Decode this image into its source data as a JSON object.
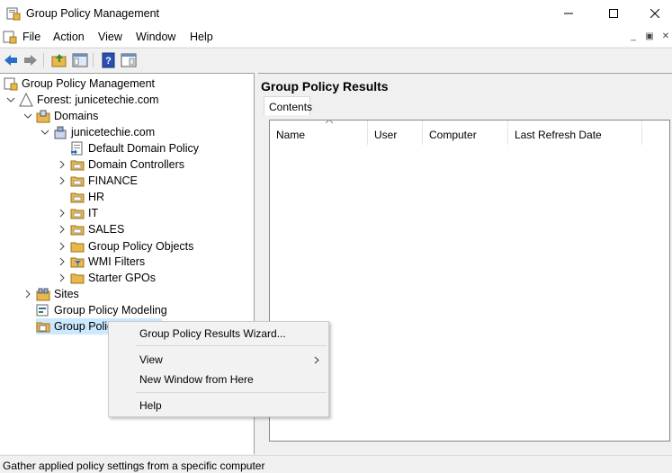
{
  "window": {
    "title": "Group Policy Management"
  },
  "menubar": {
    "items": [
      "File",
      "Action",
      "View",
      "Window",
      "Help"
    ]
  },
  "tree": {
    "root": "Group Policy Management",
    "forest": "Forest: junicetechie.com",
    "domains": "Domains",
    "domain": "junicetechie.com",
    "children": [
      "Default Domain Policy",
      "Domain Controllers",
      "FINANCE",
      "HR",
      "IT",
      "SALES",
      "Group Policy Objects",
      "WMI Filters",
      "Starter GPOs"
    ],
    "sites": "Sites",
    "modeling": "Group Policy Modeling",
    "results": "Group Policy Results"
  },
  "right_pane": {
    "title": "Group Policy Results",
    "tab": "Contents",
    "columns": [
      "Name",
      "User",
      "Computer",
      "Last Refresh Date"
    ]
  },
  "context_menu": {
    "wizard": "Group Policy Results Wizard...",
    "view": "View",
    "new_window": "New Window from Here",
    "help": "Help"
  },
  "status": {
    "text": "Gather applied policy settings from a specific computer"
  },
  "colors": {
    "folder": "#e8b84a",
    "nav_arrow": "#2a6ec6",
    "selection": "#cce8ff"
  }
}
